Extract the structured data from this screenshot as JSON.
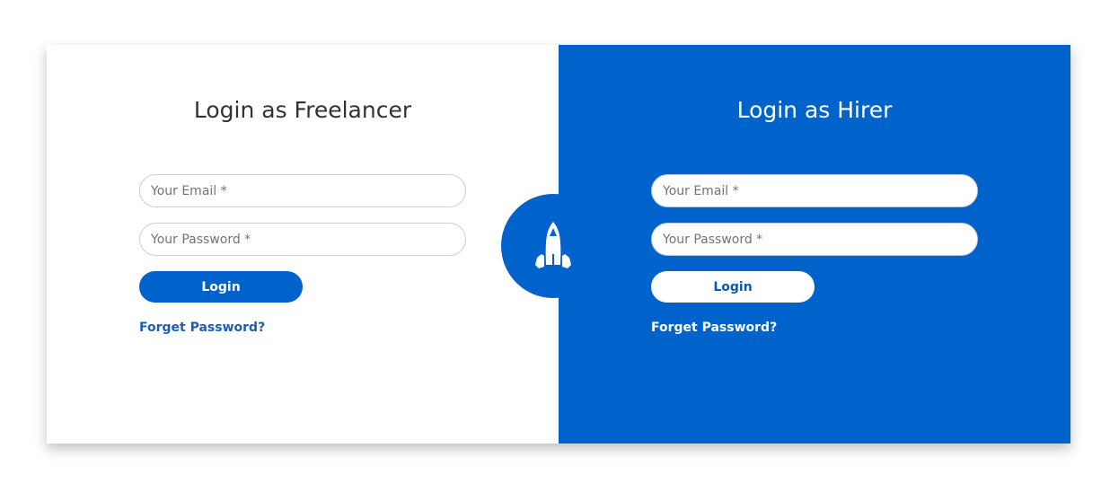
{
  "colors": {
    "brand": "#0063cc",
    "link": "#1a5fb4"
  },
  "freelancer": {
    "title": "Login as Freelancer",
    "email_placeholder": "Your Email *",
    "password_placeholder": "Your Password *",
    "login_label": "Login",
    "forgot_label": "Forget Password?"
  },
  "hirer": {
    "title": "Login as Hirer",
    "email_placeholder": "Your Email *",
    "password_placeholder": "Your Password *",
    "login_label": "Login",
    "forgot_label": "Forget Password?"
  },
  "badge": {
    "icon": "rocket-icon"
  }
}
